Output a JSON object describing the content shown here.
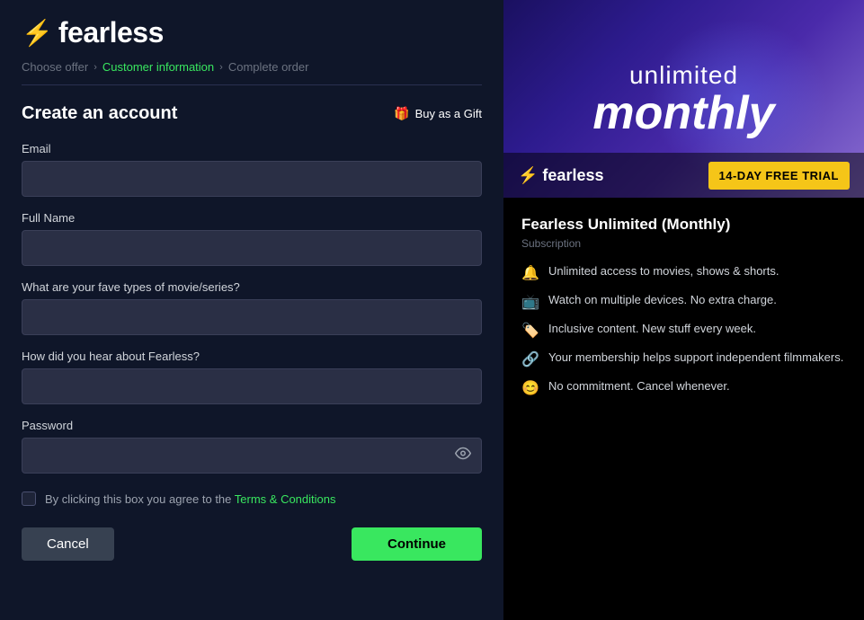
{
  "app": {
    "name": "fearless",
    "bolt_icon": "⚡"
  },
  "breadcrumb": {
    "step1": "Choose offer",
    "step2": "Customer information",
    "step3": "Complete order"
  },
  "form": {
    "title": "Create an account",
    "buy_as_gift_label": "Buy as a Gift",
    "gift_icon": "🎁",
    "email_label": "Email",
    "email_placeholder": "",
    "fullname_label": "Full Name",
    "fullname_placeholder": "",
    "movietype_label": "What are your fave types of movie/series?",
    "movietype_placeholder": "",
    "hear_label": "How did you hear about Fearless?",
    "hear_placeholder": "",
    "password_label": "Password",
    "password_placeholder": "",
    "eye_icon": "👁",
    "terms_text": "By clicking this box you agree to the ",
    "terms_link_text": "Terms & Conditions",
    "cancel_label": "Cancel",
    "continue_label": "Continue"
  },
  "promo": {
    "unlimited_text": "unlimited",
    "monthly_text": "monthly",
    "logo_text": "fearless",
    "bolt_icon": "⚡",
    "trial_badge": "14-DAY FREE TRIAL",
    "sub_title": "Fearless Unlimited (Monthly)",
    "sub_type": "Subscription",
    "features": [
      {
        "icon": "🔔",
        "text": "Unlimited access to movies, shows & shorts."
      },
      {
        "icon": "📺",
        "text": "Watch on multiple devices. No extra charge."
      },
      {
        "icon": "🏷️",
        "text": "Inclusive content. New stuff every week."
      },
      {
        "icon": "🔗",
        "text": "Your membership helps support independent filmmakers."
      },
      {
        "icon": "😊",
        "text": "No commitment. Cancel whenever."
      }
    ]
  }
}
